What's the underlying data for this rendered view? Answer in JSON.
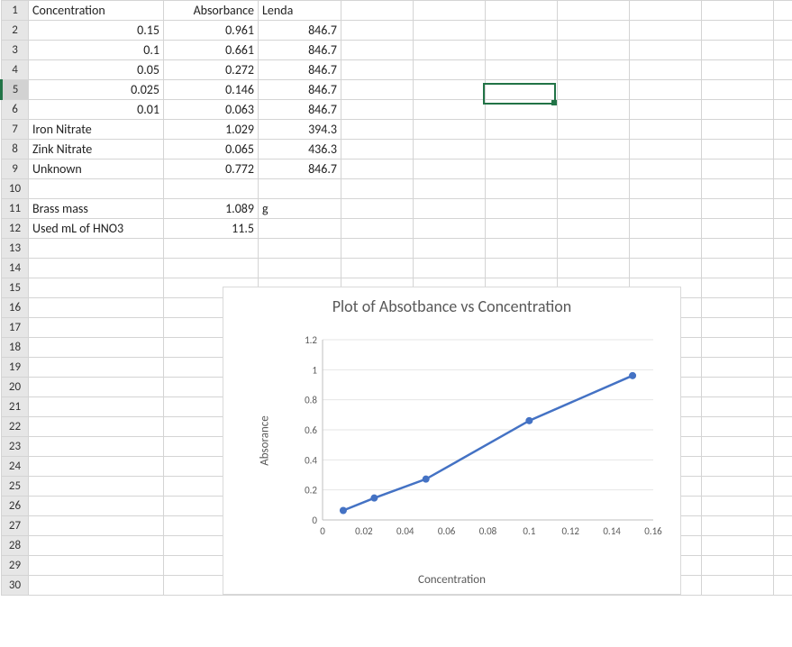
{
  "spreadsheet": {
    "headers": {
      "A": "Concentration",
      "B": "Absorbance",
      "C": "Lenda"
    },
    "rows": [
      {
        "A": "0.15",
        "B": "0.961",
        "C": "846.7"
      },
      {
        "A": "0.1",
        "B": "0.661",
        "C": "846.7"
      },
      {
        "A": "0.05",
        "B": "0.272",
        "C": "846.7"
      },
      {
        "A": "0.025",
        "B": "0.146",
        "C": "846.7"
      },
      {
        "A": "0.01",
        "B": "0.063",
        "C": "846.7"
      }
    ],
    "labeled": [
      {
        "A": "Iron Nitrate",
        "B": "1.029",
        "C": "394.3"
      },
      {
        "A": "Zink Nitrate",
        "B": "0.065",
        "C": "436.3"
      },
      {
        "A": "Unknown",
        "B": "0.772",
        "C": "846.7"
      }
    ],
    "extras": [
      {
        "A": "Brass mass",
        "B": "1.089",
        "C": "g"
      },
      {
        "A": "Used mL of HNO3",
        "B": "11.5",
        "C": ""
      }
    ],
    "selected_row": 5
  },
  "chart_data": {
    "type": "line",
    "title": "Plot of Absotbance vs Concentration",
    "xlabel": "Concentration",
    "ylabel": "Absorance",
    "x": [
      0.01,
      0.025,
      0.05,
      0.1,
      0.15
    ],
    "y": [
      0.063,
      0.146,
      0.272,
      0.661,
      0.961
    ],
    "xlim": [
      0,
      0.16
    ],
    "ylim": [
      0,
      1.2
    ],
    "xticks": [
      0,
      0.02,
      0.04,
      0.06,
      0.08,
      0.1,
      0.12,
      0.14,
      0.16
    ],
    "yticks": [
      0,
      0.2,
      0.4,
      0.6,
      0.8,
      1,
      1.2
    ],
    "series_color": "#4472C4"
  }
}
